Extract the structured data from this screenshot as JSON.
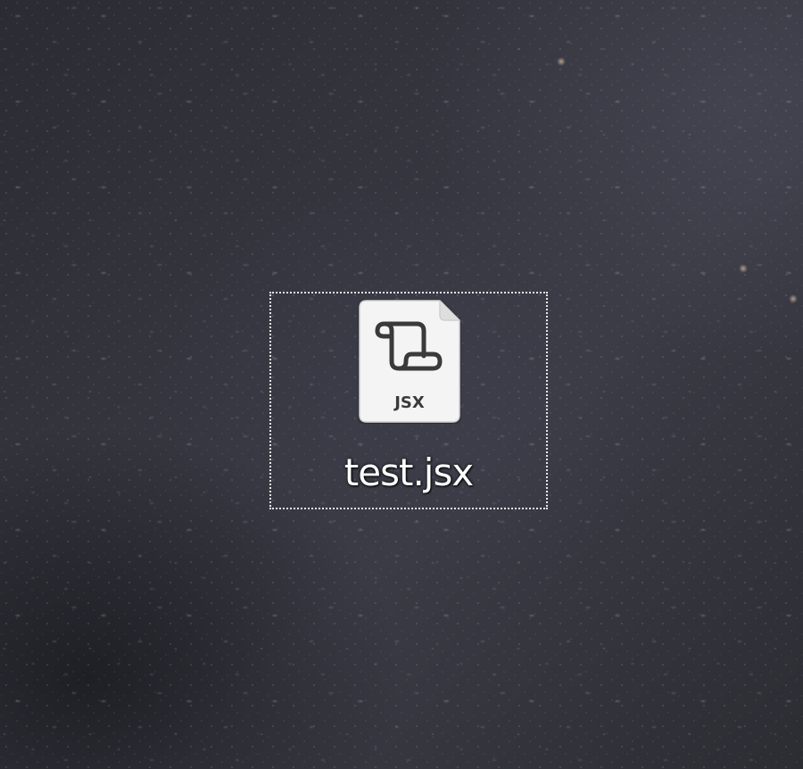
{
  "desktop": {
    "icons": [
      {
        "filename": "test.jsx",
        "icon": "jsx-script-file-icon",
        "badge": "JSX",
        "selected": true
      }
    ]
  },
  "colors": {
    "wallpaper": "#34353d",
    "label_text": "#ffffff",
    "icon_page": "#f4f4f4",
    "icon_glyph": "#3a3a3a",
    "selection_border": "#e8e8e8"
  }
}
